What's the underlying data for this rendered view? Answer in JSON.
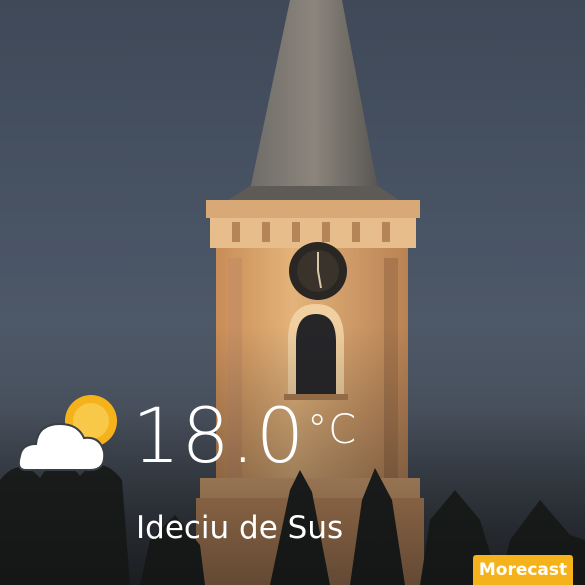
{
  "weather": {
    "temperature": "18.0",
    "unit": "°C",
    "condition_icon": "partly-cloudy-icon",
    "location": "Ideciu de Sus"
  },
  "brand": {
    "name": "Morecast",
    "color": "#f6b21a"
  },
  "background": {
    "subject": "church-steeple-photo"
  }
}
